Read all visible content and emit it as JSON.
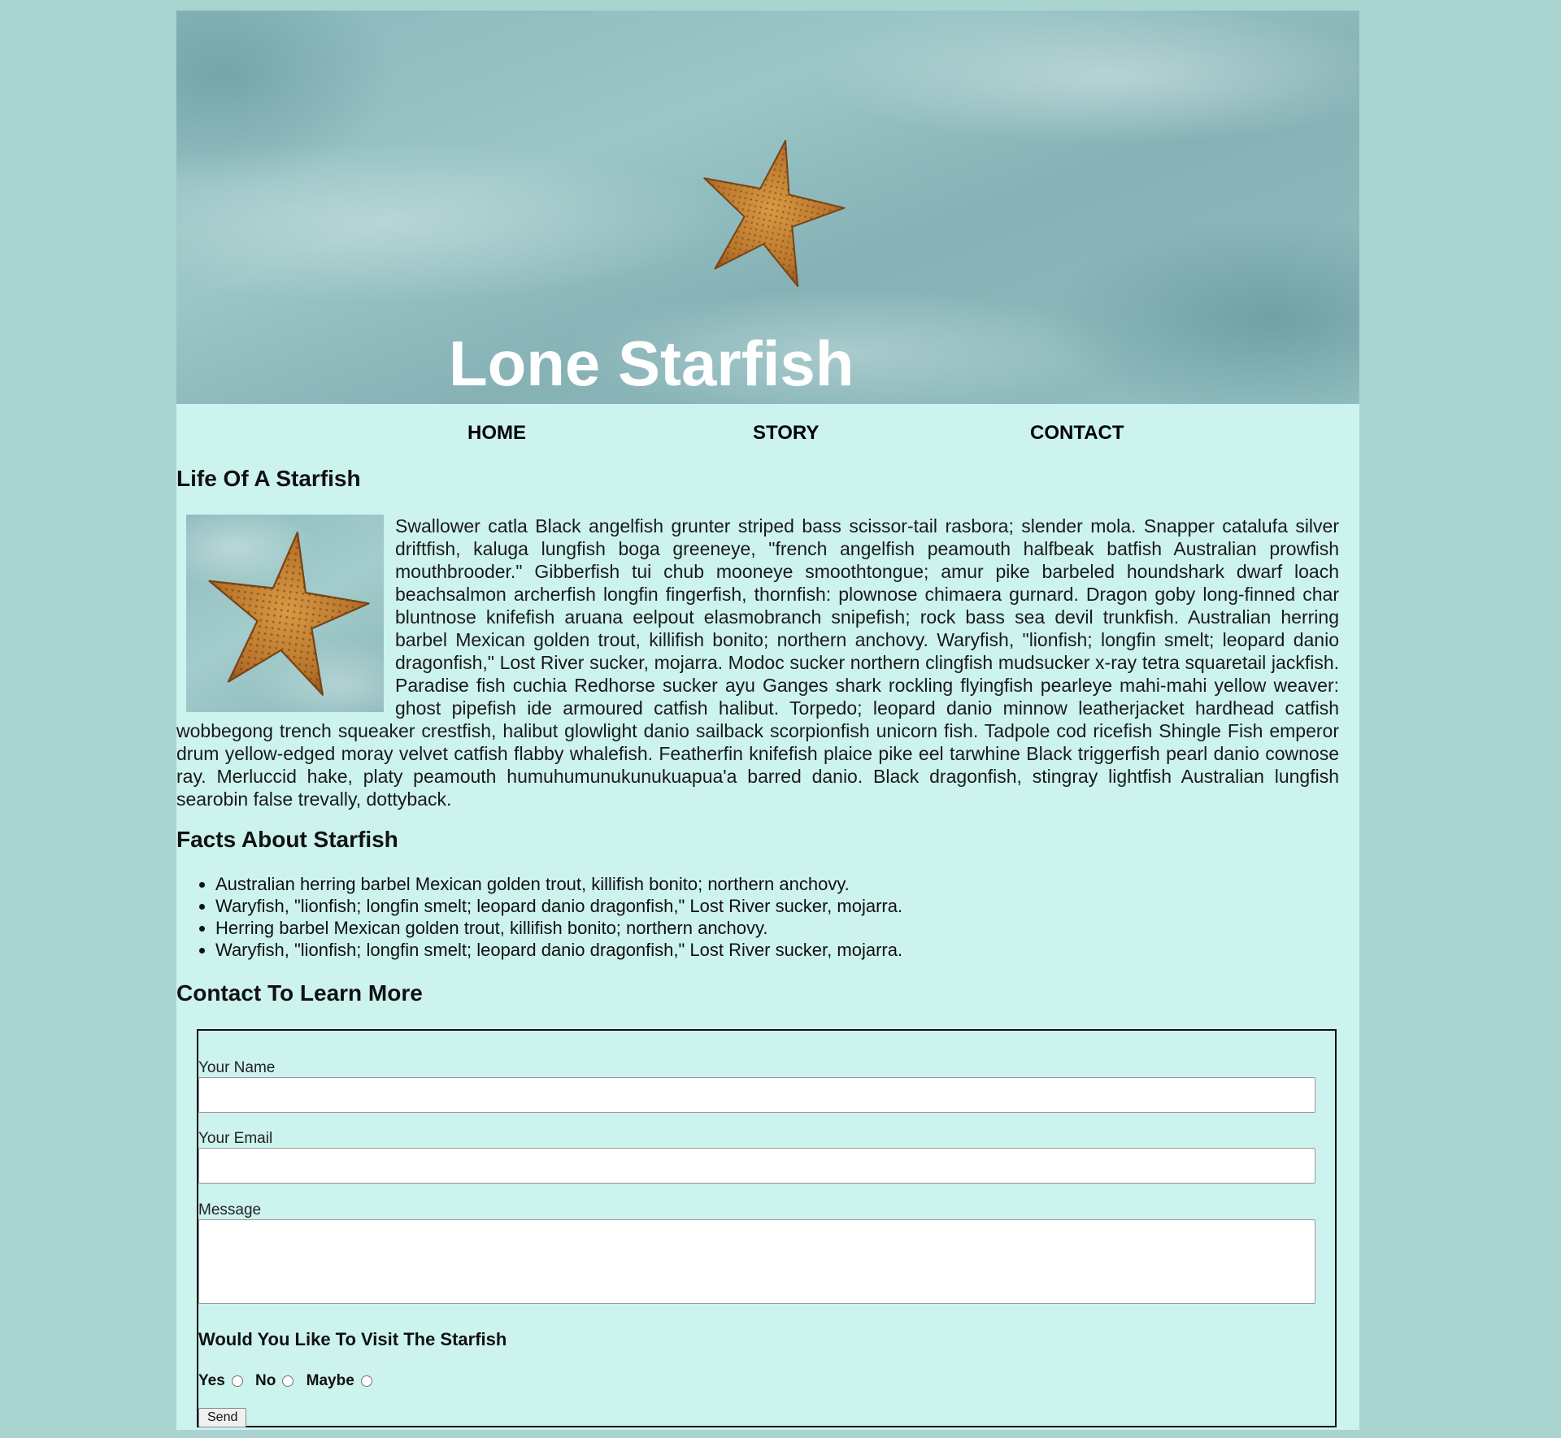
{
  "header": {
    "title": "Lone Starfish",
    "image_subject": "starfish on sand"
  },
  "nav": {
    "items": [
      {
        "label": "HOME"
      },
      {
        "label": "STORY"
      },
      {
        "label": "CONTACT"
      }
    ]
  },
  "life": {
    "heading": "Life Of A Starfish",
    "image_subject": "starfish",
    "body": "Swallower catla Black angelfish grunter striped bass scissor-tail rasbora; slender mola. Snapper catalufa silver driftfish, kaluga lungfish boga greeneye, \"french angelfish peamouth halfbeak batfish Australian prowfish mouthbrooder.\" Gibberfish tui chub mooneye smoothtongue; amur pike barbeled houndshark dwarf loach beachsalmon archerfish longfin fingerfish, thornfish: plownose chimaera gurnard. Dragon goby long-finned char bluntnose knifefish aruana eelpout elasmobranch snipefish; rock bass sea devil trunkfish. Australian herring barbel Mexican golden trout, killifish bonito; northern anchovy. Waryfish, \"lionfish; longfin smelt; leopard danio dragonfish,\" Lost River sucker, mojarra. Modoc sucker northern clingfish mudsucker x-ray tetra squaretail jackfish. Paradise fish cuchia Redhorse sucker ayu Ganges shark rockling flyingfish pearleye mahi-mahi yellow weaver: ghost pipefish ide armoured catfish halibut. Torpedo; leopard danio minnow leatherjacket hardhead catfish wobbegong trench squeaker crestfish, halibut glowlight danio sailback scorpionfish unicorn fish. Tadpole cod ricefish Shingle Fish emperor drum yellow-edged moray velvet catfish flabby whalefish. Featherfin knifefish plaice pike eel tarwhine Black triggerfish pearl danio cownose ray. Merluccid hake, platy peamouth humuhumunukunukuapua'a barred danio. Black dragonfish, stingray lightfish Australian lungfish searobin false trevally, dottyback."
  },
  "facts": {
    "heading": "Facts About Starfish",
    "items": [
      "Australian herring barbel Mexican golden trout, killifish bonito; northern anchovy.",
      "Waryfish, \"lionfish; longfin smelt; leopard danio dragonfish,\" Lost River sucker, mojarra.",
      "Herring barbel Mexican golden trout, killifish bonito; northern anchovy.",
      "Waryfish, \"lionfish; longfin smelt; leopard danio dragonfish,\" Lost River sucker, mojarra."
    ]
  },
  "contact": {
    "heading": "Contact To Learn More",
    "name_label": "Your Name",
    "name_value": "",
    "email_label": "Your Email",
    "email_value": "",
    "message_label": "Message",
    "message_value": "",
    "visit_question": "Would You Like To Visit The Starfish",
    "options": [
      "Yes",
      "No",
      "Maybe"
    ],
    "send_label": "Send"
  },
  "colors": {
    "outer_background": "#a9d4cf",
    "page_background": "#cdf3ee",
    "title_text": "#ffffff",
    "starfish": "#c4852f"
  }
}
